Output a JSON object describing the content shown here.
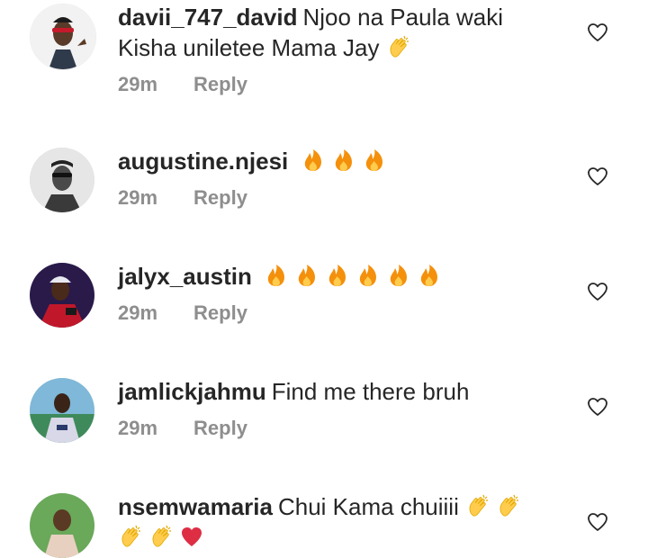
{
  "comments": [
    {
      "username": "davii_747_david",
      "text": "Njoo na Paula waki Kisha uniletee Mama Jay",
      "emojis": [
        "clapping-hands-icon"
      ],
      "time": "29m",
      "reply": "Reply"
    },
    {
      "username": "augustine.njesi",
      "text": "",
      "emojis": [
        "fire-icon",
        "fire-icon",
        "fire-icon"
      ],
      "time": "29m",
      "reply": "Reply"
    },
    {
      "username": "jalyx_austin",
      "text": "",
      "emojis": [
        "fire-icon",
        "fire-icon",
        "fire-icon",
        "fire-icon",
        "fire-icon",
        "fire-icon"
      ],
      "time": "29m",
      "reply": "Reply"
    },
    {
      "username": "jamlickjahmu",
      "text": "Find me there bruh",
      "emojis": [],
      "time": "29m",
      "reply": "Reply"
    },
    {
      "username": "nsemwamaria",
      "text": "Chui Kama chuiiii",
      "emojis": [
        "clapping-hands-icon",
        "clapping-hands-icon",
        "clapping-hands-icon",
        "clapping-hands-icon",
        "red-heart-icon"
      ],
      "time": "",
      "reply": ""
    }
  ],
  "colors": {
    "text": "#262626",
    "meta": "#8e8e8e",
    "fire": "#f4900c",
    "clap": "#ffcc4d",
    "heart": "#dd2e44"
  },
  "icons": {
    "like": "heart-outline-icon"
  }
}
